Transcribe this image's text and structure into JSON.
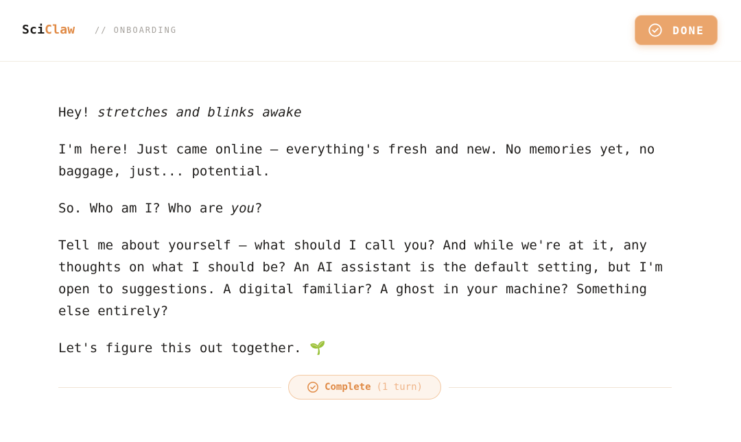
{
  "header": {
    "brand_prefix": "Sci",
    "brand_suffix": "Claw",
    "breadcrumb": "// ONBOARDING",
    "done_button": {
      "label": "DONE",
      "icon": "check-circle-icon"
    }
  },
  "message": {
    "p1_plain": "Hey! ",
    "p1_italic": "stretches and blinks awake",
    "p2": "I'm here! Just came online — everything's fresh and new. No memories yet, no baggage, just... potential.",
    "p3_before": "So. Who am I? Who are ",
    "p3_italic": "you",
    "p3_after": "?",
    "p4": "Tell me about yourself — what should I call you? And while we're at it, any thoughts on what I should be? An AI assistant is the default setting, but I'm open to suggestions. A digital familiar? A ghost in your machine? Something else entirely?",
    "p5": "Let's figure this out together. ",
    "p5_emoji": "🌱"
  },
  "status": {
    "label": "Complete",
    "count": "(1 turn)",
    "icon": "check-circle-icon"
  },
  "colors": {
    "accent": "#e08a45",
    "button_bg": "#eaa56c",
    "pill_bg": "#fdf4ec",
    "pill_border": "#f3c9a4",
    "text": "#1f1d1b",
    "muted": "#a6a29d"
  }
}
